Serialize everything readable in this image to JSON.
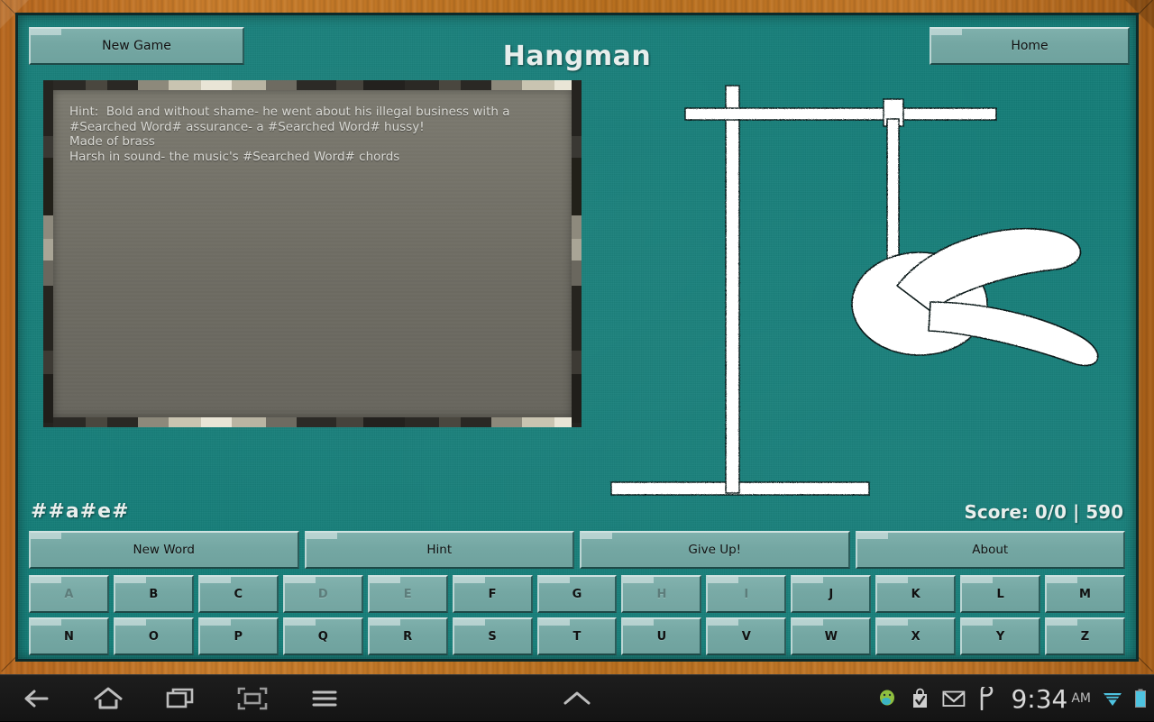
{
  "app": {
    "title": "Hangman"
  },
  "topbar": {
    "new_game_label": "New Game",
    "home_label": "Home"
  },
  "hint": {
    "text": "Hint:  Bold and without shame- he went about his illegal business with a #Searched Word# assurance- a #Searched Word# hussy!\nMade of brass\nHarsh in sound- the music's #Searched Word# chords"
  },
  "game": {
    "word_display": "##a#e#",
    "score_text": "Score: 0/0  |  590",
    "gallows_parts": [
      "post",
      "crossbeam",
      "base",
      "rope",
      "head",
      "arms"
    ],
    "board_color": "#147d78",
    "frame_color": "#b9701f",
    "chalk_color": "#ffffff"
  },
  "actions": [
    {
      "label": "New Word"
    },
    {
      "label": "Hint"
    },
    {
      "label": "Give Up!"
    },
    {
      "label": "About"
    }
  ],
  "keyboard": {
    "rows": [
      [
        {
          "letter": "A",
          "used": true
        },
        {
          "letter": "B",
          "used": false
        },
        {
          "letter": "C",
          "used": false
        },
        {
          "letter": "D",
          "used": true
        },
        {
          "letter": "E",
          "used": true
        },
        {
          "letter": "F",
          "used": false
        },
        {
          "letter": "G",
          "used": false
        },
        {
          "letter": "H",
          "used": true
        },
        {
          "letter": "I",
          "used": true
        },
        {
          "letter": "J",
          "used": false
        },
        {
          "letter": "K",
          "used": false
        },
        {
          "letter": "L",
          "used": false
        },
        {
          "letter": "M",
          "used": false
        }
      ],
      [
        {
          "letter": "N",
          "used": false
        },
        {
          "letter": "O",
          "used": false
        },
        {
          "letter": "P",
          "used": false
        },
        {
          "letter": "Q",
          "used": false
        },
        {
          "letter": "R",
          "used": false
        },
        {
          "letter": "S",
          "used": false
        },
        {
          "letter": "T",
          "used": false
        },
        {
          "letter": "U",
          "used": false
        },
        {
          "letter": "V",
          "used": false
        },
        {
          "letter": "W",
          "used": false
        },
        {
          "letter": "X",
          "used": false
        },
        {
          "letter": "Y",
          "used": false
        },
        {
          "letter": "Z",
          "used": false
        }
      ]
    ]
  },
  "system_bar": {
    "nav": [
      "back-icon",
      "home-icon",
      "recents-icon",
      "screenshot-icon",
      "menu-icon"
    ],
    "expand": "chevron-up-icon",
    "tray": [
      "android-icon",
      "checkmark-bag-icon",
      "gmail-icon",
      "pocket-icon"
    ],
    "clock": "9:34",
    "clock_ampm": "AM",
    "status": [
      "wifi-icon",
      "battery-icon"
    ]
  }
}
